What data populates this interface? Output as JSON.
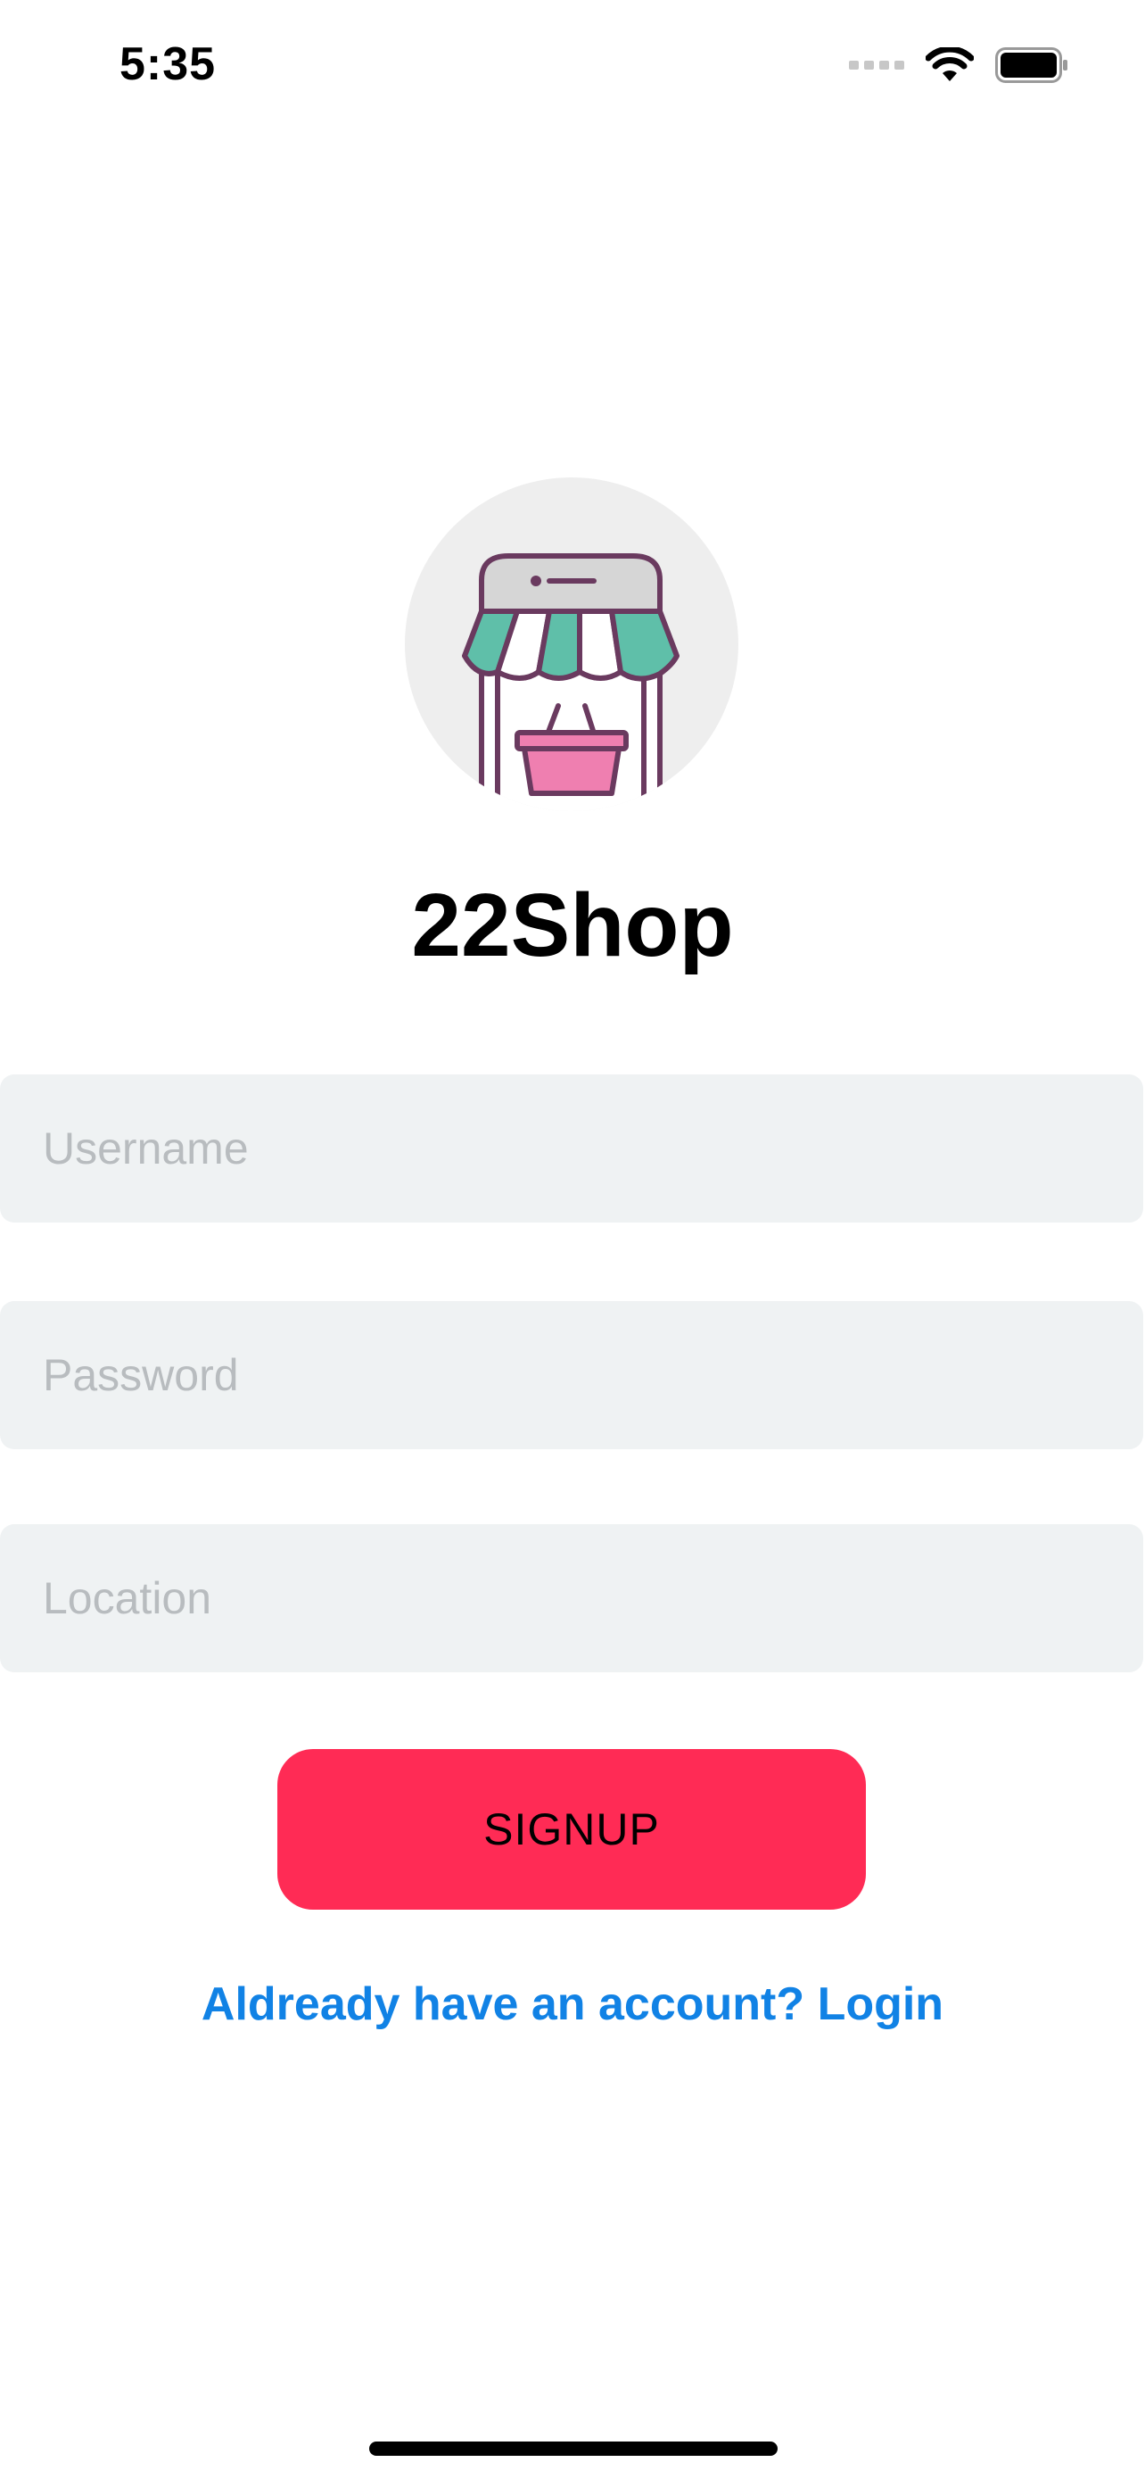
{
  "status_bar": {
    "time": "5:35",
    "icons": [
      "cellular-signal-icon",
      "wifi-icon",
      "battery-icon"
    ]
  },
  "app": {
    "logo_icon": "storefront-basket-icon",
    "title": "22Shop"
  },
  "form": {
    "username": {
      "placeholder": "Username",
      "value": ""
    },
    "password": {
      "placeholder": "Password",
      "value": ""
    },
    "location": {
      "placeholder": "Location",
      "value": ""
    },
    "signup_label": "SIGNUP",
    "login_link": "Aldready have an account? Login"
  },
  "colors": {
    "accent_button": "#ff2b55",
    "link": "#1182e5",
    "field_background": "#eff2f3",
    "placeholder": "#b8bcbf",
    "logo_background": "#eeeeee",
    "awning_green": "#5fbfa9",
    "basket_pink": "#ef7fb0",
    "outline_purple": "#6a3a5f"
  }
}
